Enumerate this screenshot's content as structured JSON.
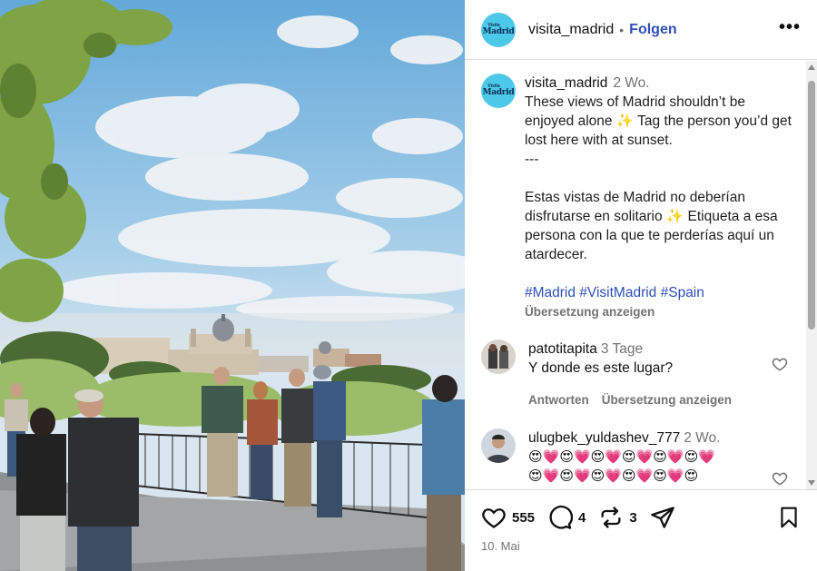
{
  "post": {
    "username": "visita_madrid",
    "separator": "•",
    "follow_label": "Folgen",
    "more_label": "•••",
    "avatar": {
      "mini_text": "Visita",
      "big_text": "Madrid",
      "color": "#4cc9e8"
    },
    "caption": {
      "time": "2 Wo.",
      "line1": "These views of Madrid shouldn’t be enjoyed alone ✨ Tag the person you’d get lost here with at sunset.",
      "line2": "---",
      "line3": "Estas vistas de Madrid no deberían disfrutarse en solitario ✨ Etiqueta a esa persona con la que te perderías aquí un atardecer.",
      "hashtags": "#Madrid #VisitMadrid #Spain",
      "translate_label": "Übersetzung anzeigen"
    },
    "comments": [
      {
        "user": "patotitapita",
        "time": "3 Tage",
        "text": "Y donde es este lugar?",
        "reply_label": "Antworten",
        "translate_label": "Übersetzung anzeigen"
      },
      {
        "user": "ulugbek_yuldashev_777",
        "time": "2 Wo.",
        "emoji_line1": "😍💗😍💗😍💗😍💗😍💗😍💗",
        "emoji_line2": "😍💗😍💗😍💗😍💗😍💗😍"
      }
    ],
    "likes": "555",
    "comments_count": "4",
    "reposts": "3",
    "date": "10. Mai",
    "accent_color": "#2e50b8"
  }
}
